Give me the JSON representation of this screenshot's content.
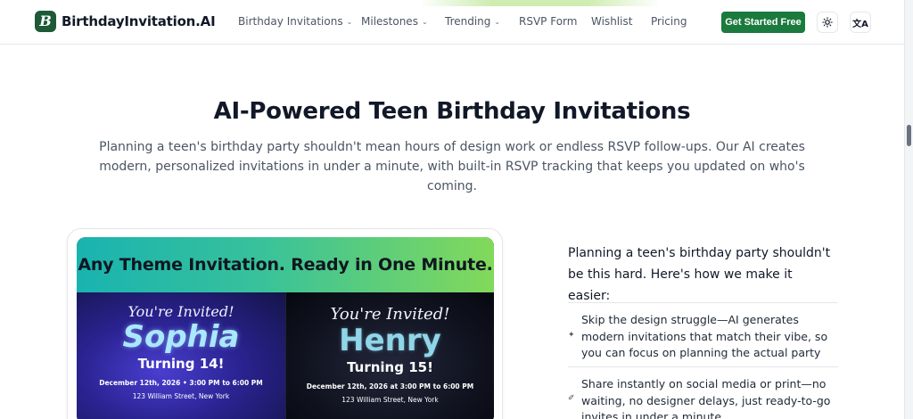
{
  "header": {
    "logo_mark": "B",
    "logo_text": "BirthdayInvitation.AI",
    "nav": [
      {
        "label": "Birthday Invitations",
        "dropdown": true
      },
      {
        "label": "Milestones",
        "dropdown": true
      },
      {
        "label": "Trending",
        "dropdown": true
      },
      {
        "label": "RSVP Form",
        "dropdown": false
      },
      {
        "label": "Wishlist",
        "dropdown": false
      },
      {
        "label": "Pricing",
        "dropdown": false
      }
    ],
    "cta_label": "Get Started Free",
    "theme_icon": "sun-icon",
    "language_icon": "translate-icon"
  },
  "hero": {
    "title": "AI-Powered Teen Birthday Invitations",
    "subtitle": "Planning a teen's birthday party shouldn't mean hours of design work or endless RSVP follow-ups. Our AI creates modern, personalized invitations in under a minute, with built-in RSVP tracking that keeps you updated on who's coming."
  },
  "promo": {
    "banner": "Any Theme Invitation. Ready in One Minute.",
    "invites": [
      {
        "invited": "You're Invited!",
        "name": "Sophia",
        "turning": "Turning 14!",
        "date": "December 12th, 2026 • 3:00 PM to 6:00 PM",
        "address": "123 William Street, New York"
      },
      {
        "invited": "You're Invited!",
        "name": "Henry",
        "turning": "Turning 15!",
        "date": "December 12th, 2026 at 3:00 PM to 6:00 PM",
        "address": "123 William Street, New York"
      }
    ]
  },
  "features": {
    "lead": "Planning a teen's birthday party shouldn't be this hard. Here's how we make it easier:",
    "items": [
      {
        "icon": "sparkle-icon",
        "text": "Skip the design struggle—AI generates modern invitations that match their vibe, so you can focus on planning the actual party"
      },
      {
        "icon": "send-icon",
        "text": "Share instantly on social media or print—no waiting, no designer delays, just ready-to-go invites in under a minute"
      }
    ]
  },
  "colors": {
    "brand": "#1b7a3e",
    "logo_bg": "#1f5a37",
    "banner_start": "#19b3b0",
    "banner_end": "#82d95a"
  }
}
